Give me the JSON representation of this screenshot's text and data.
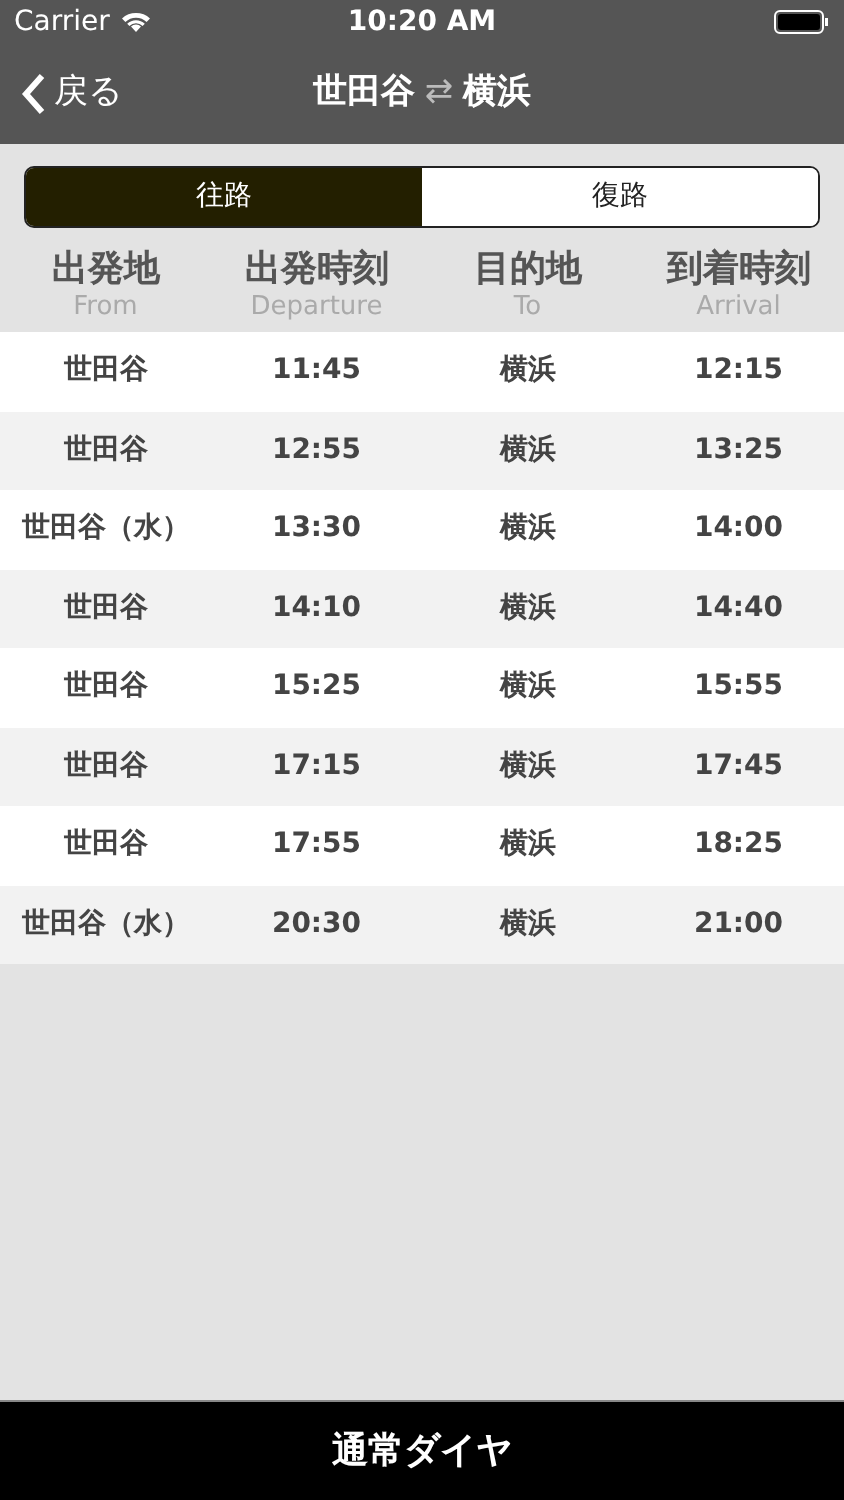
{
  "status_bar": {
    "carrier": "Carrier",
    "time": "10:20 AM"
  },
  "nav": {
    "back": "戻る",
    "title_from": "世田谷",
    "title_arrow": "⇄",
    "title_to": "横浜"
  },
  "tabs": [
    {
      "label": "往路",
      "selected": true
    },
    {
      "label": "復路",
      "selected": false
    }
  ],
  "columns": [
    {
      "label": "出発地",
      "sub": "From"
    },
    {
      "label": "出発時刻",
      "sub": "Departure"
    },
    {
      "label": "目的地",
      "sub": "To"
    },
    {
      "label": "到着時刻",
      "sub": "Arrival"
    }
  ],
  "rows": [
    [
      "世田谷",
      "11:45",
      "横浜",
      "12:15"
    ],
    [
      "世田谷",
      "12:55",
      "横浜",
      "13:25"
    ],
    [
      "世田谷（水）",
      "13:30",
      "横浜",
      "14:00"
    ],
    [
      "世田谷",
      "14:10",
      "横浜",
      "14:40"
    ],
    [
      "世田谷",
      "15:25",
      "横浜",
      "15:55"
    ],
    [
      "世田谷",
      "17:15",
      "横浜",
      "17:45"
    ],
    [
      "世田谷",
      "17:55",
      "横浜",
      "18:25"
    ],
    [
      "世田谷（水）",
      "20:30",
      "横浜",
      "21:00"
    ]
  ],
  "bottom_bar": "通常ダイヤ"
}
